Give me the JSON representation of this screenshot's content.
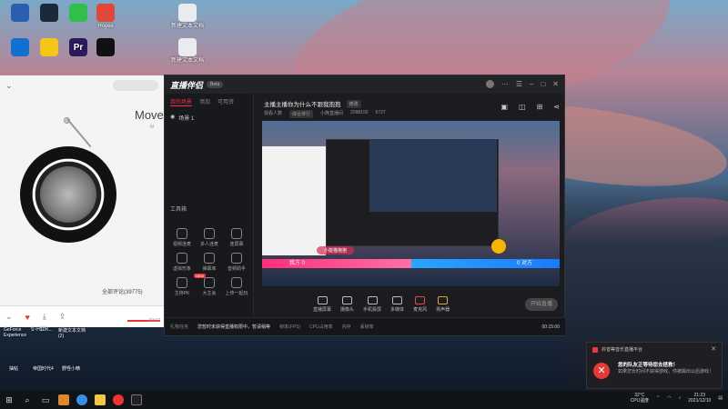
{
  "desktop_icons": [
    {
      "label": "",
      "color": "#2a5fb0"
    },
    {
      "label": "",
      "color": "#1a2a3a"
    },
    {
      "label": "",
      "color": "#2fbf4a"
    },
    {
      "label": "Hoyee",
      "color": "#e2483a"
    },
    {
      "label": "新建文本文档",
      "color": "#e9ecef"
    },
    {
      "label": "",
      "color": "#1170d1"
    },
    {
      "label": "",
      "color": "#f5c518"
    },
    {
      "label": "Pr",
      "color": "#2b1a5c"
    },
    {
      "label": "",
      "color": "#111"
    },
    {
      "label": "新建文本文档",
      "color": "#e9ecef"
    }
  ],
  "music": {
    "song_title": "Move",
    "song_sub": "M",
    "comments": "全部评论(39775)",
    "time": "00:02"
  },
  "app": {
    "logo": "直播伴侣",
    "badge": "Beta",
    "left_tabs": [
      "我的场景",
      "添加",
      "可用资"
    ],
    "scene_name": "场景 1",
    "tools_title": "工具箱",
    "stats": [
      "",
      "",
      "",
      ""
    ],
    "tools": [
      {
        "label": "视频连麦"
      },
      {
        "label": "多人连麦"
      },
      {
        "label": "连屏幕"
      },
      {
        "label": "虚拟形象"
      },
      {
        "label": "弹幕库"
      },
      {
        "label": "音频助手"
      },
      {
        "label": "主持PK",
        "hot": "NEW"
      },
      {
        "label": "大主会",
        "hot": ""
      },
      {
        "label": "上传一起玩"
      }
    ],
    "room_title": "主播主播你为什么不跟我抱抱",
    "room_edit": "修改",
    "room_meta": [
      "观看人数",
      "综合排行",
      "小熊直播间",
      "2098150",
      "5727"
    ],
    "pk_left": "我方 0",
    "pk_right": "0 对方",
    "pk_gift": "小能猫抱抱",
    "bottom_tools": [
      "直播屏幕",
      "摄像头",
      "手机投屏",
      "多媒体",
      "麦克风",
      "扬声器"
    ],
    "go_live": "开始直播",
    "status": [
      "礼物任务",
      "您暂时未获得直播权限中，暂请稍等",
      "帧率(FPS)",
      "CPU占用率",
      "内存",
      "丢帧率"
    ],
    "rec": "00:15:00"
  },
  "notification": {
    "source": "抖音等音乐直播平台",
    "title": "您的队友正等待您去拯救！",
    "body": "如果您长时间不获得游戏，你被踢出以后游戏！"
  },
  "taskbar": {
    "thumbs": [
      "GeForce Experience",
      "S~H$DK...",
      "新建文本文档(2)",
      "抽帖",
      "帝国时代4",
      "野怪小精"
    ],
    "temp": "32°C",
    "cpu_label": "CPU温度",
    "time": "21:23",
    "date": "2021/12/10"
  }
}
